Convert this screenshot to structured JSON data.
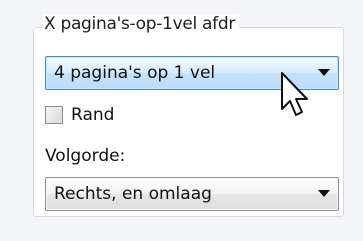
{
  "group": {
    "title": "X pagina's-op-1vel afdr"
  },
  "pages_per_sheet": {
    "selected": "4 pagina's op 1 vel"
  },
  "border": {
    "label": "Rand",
    "checked": false
  },
  "order": {
    "label": "Volgorde:",
    "selected": "Rechts, en omlaag"
  },
  "icons": {
    "dropdown": "chevron-down-icon",
    "cursor": "mouse-pointer-icon"
  },
  "colors": {
    "focus_blue": "#3f8ccf"
  }
}
